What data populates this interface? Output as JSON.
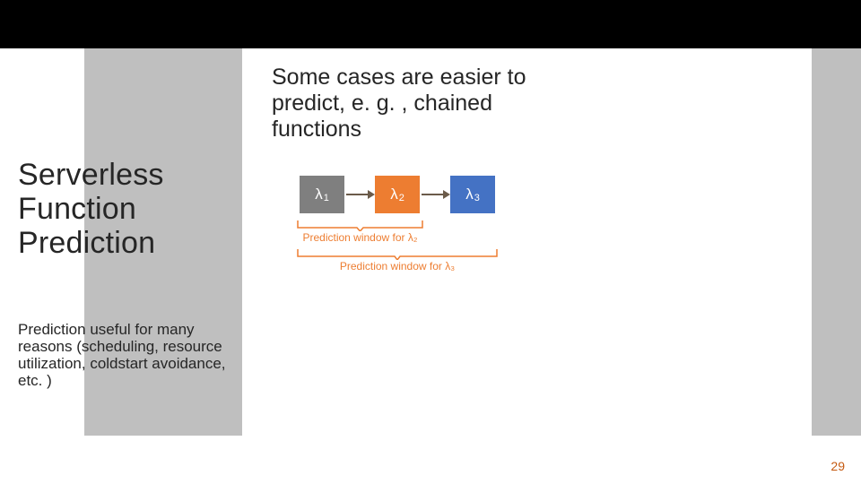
{
  "slide": {
    "title": "Serverless Function Prediction",
    "subtitle": "Prediction useful for many reasons (scheduling, resource utilization, coldstart avoidance, etc. )",
    "body_heading": "Some cases are easier to predict, e. g. , chained functions",
    "page_number": "29"
  },
  "diagram": {
    "lambdas": [
      {
        "id": "lambda-1",
        "label": "λ",
        "sub": "1",
        "color": "#7f7f7f"
      },
      {
        "id": "lambda-2",
        "label": "λ",
        "sub": "2",
        "color": "#ed7d31"
      },
      {
        "id": "lambda-3",
        "label": "λ",
        "sub": "3",
        "color": "#4472c4"
      }
    ],
    "brackets": [
      {
        "id": "pw2",
        "label": "Prediction window for λ₂"
      },
      {
        "id": "pw3",
        "label": "Prediction window for λ₃"
      }
    ]
  }
}
